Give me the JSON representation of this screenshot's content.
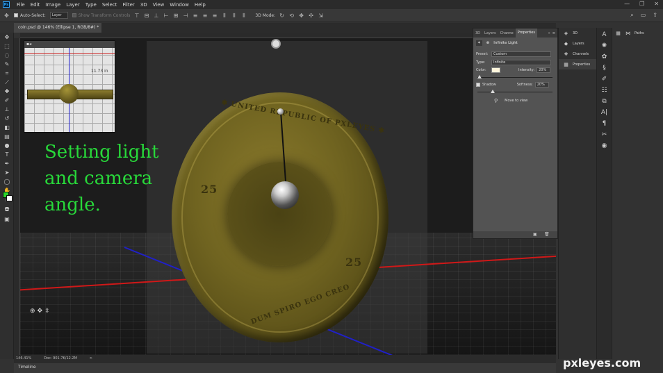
{
  "menubar": {
    "logo": "Ps",
    "items": [
      "File",
      "Edit",
      "Image",
      "Layer",
      "Type",
      "Select",
      "Filter",
      "3D",
      "View",
      "Window",
      "Help"
    ],
    "controls": [
      "—",
      "❐",
      "✕"
    ]
  },
  "options": {
    "auto_select": "Auto-Select:",
    "auto_select_value": "Layer",
    "show_transform": "Show Transform Controls",
    "mode_3d": "3D Mode:"
  },
  "document": {
    "tab_title": "coin.psd @ 146% (Ellipse 1, RGB/8#) *",
    "tab_close": "×"
  },
  "caption": {
    "lines": [
      "Setting light",
      "and camera",
      "angle."
    ]
  },
  "navigator": {
    "measure": "11.73 in"
  },
  "coin": {
    "top_text": "✱ UNITED REPUBLIC OF PXLEYES ✱",
    "bottom_text": "DUM SPIRO EGO CREO",
    "denom": "25"
  },
  "status": {
    "zoom": "146.41%",
    "doc": "Doc: 901.7K/12.2M",
    "arrow": ">"
  },
  "timeline": {
    "label": "Timeline"
  },
  "properties": {
    "tabs": [
      "3D",
      "Layers",
      "Channe",
      "Properties"
    ],
    "title": "Infinite Light",
    "preset_label": "Preset:",
    "preset_value": "Custom",
    "type_label": "Type:",
    "type_value": "Infinite",
    "color_label": "Color:",
    "intensity_label": "Intensity:",
    "intensity_value": "20%",
    "intensity_level": 0.03,
    "shadow_label": "Shadow",
    "softness_label": "Softness:",
    "softness_value": "20%",
    "softness_level": 0.2,
    "move_to_view": "Move to view"
  },
  "dock": {
    "items": [
      "3D",
      "Layers",
      "Channels",
      "Properties"
    ],
    "paths": "Paths"
  },
  "watermark": "pxleyes.com"
}
